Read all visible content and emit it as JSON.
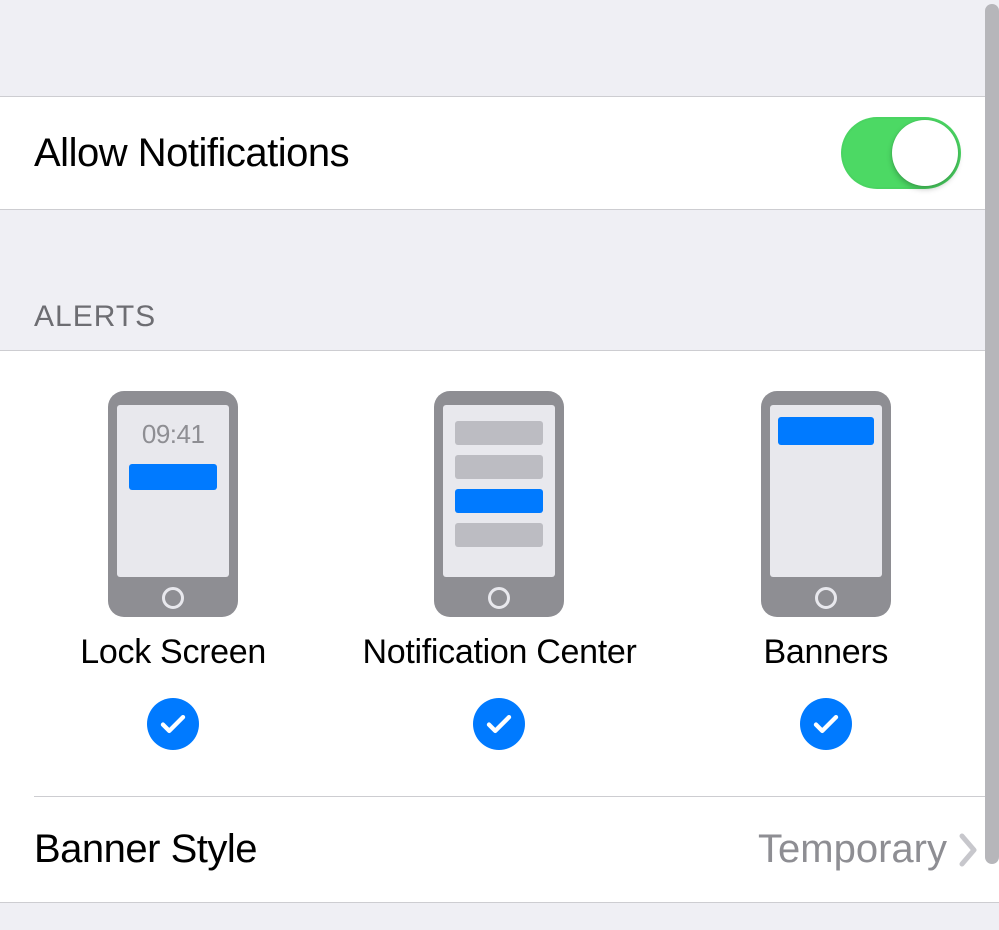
{
  "allow": {
    "label": "Allow Notifications",
    "enabled": true
  },
  "sections": {
    "alerts_header": "ALERTS"
  },
  "alerts": {
    "lock_screen": {
      "label": "Lock Screen",
      "checked": true,
      "time": "09:41"
    },
    "notification_center": {
      "label": "Notification Center",
      "checked": true
    },
    "banners": {
      "label": "Banners",
      "checked": true
    }
  },
  "banner_style": {
    "label": "Banner Style",
    "value": "Temporary"
  }
}
